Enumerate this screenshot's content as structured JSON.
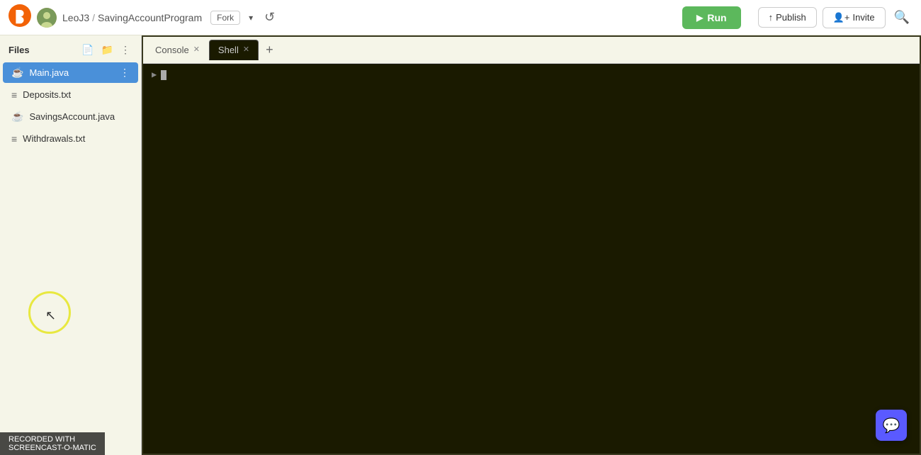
{
  "navbar": {
    "logo_alt": "Replit logo",
    "user": "LeoJ3",
    "separator": "/",
    "project": "SavingAccountProgram",
    "fork_label": "Fork",
    "run_label": "Run",
    "publish_label": "Publish",
    "invite_label": "Invite"
  },
  "sidebar": {
    "title": "Files",
    "files": [
      {
        "name": "Main.java",
        "type": "java",
        "active": true
      },
      {
        "name": "Deposits.txt",
        "type": "txt",
        "active": false
      },
      {
        "name": "SavingsAccount.java",
        "type": "java",
        "active": false
      },
      {
        "name": "Withdrawals.txt",
        "type": "txt",
        "active": false
      }
    ]
  },
  "console": {
    "tabs": [
      {
        "label": "Console",
        "active": false,
        "closable": true
      },
      {
        "label": "Shell",
        "active": true,
        "closable": true
      }
    ],
    "add_tab_label": "+",
    "prompt_symbol": ">",
    "cursor": ""
  },
  "watermark": {
    "line1": "RECORDED WITH",
    "line2": "SCREENCAST-O-MATIC"
  },
  "chat": {
    "icon": "💬"
  }
}
